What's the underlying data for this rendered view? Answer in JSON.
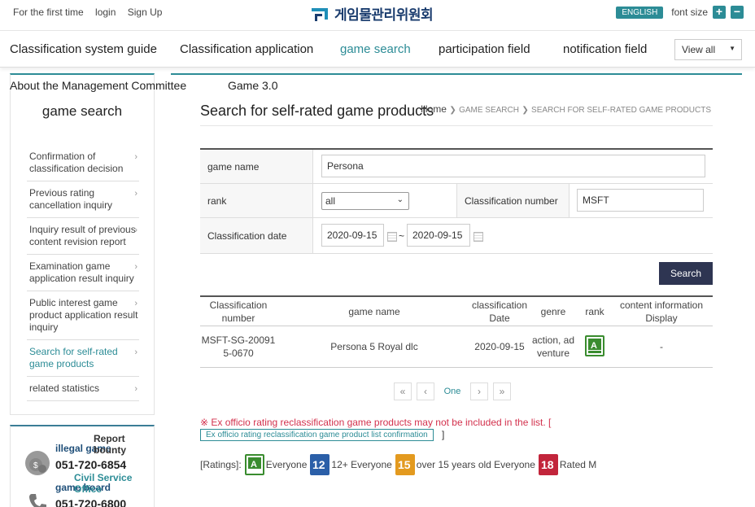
{
  "top": {
    "links": [
      "For the first time",
      "login",
      "Sign Up"
    ],
    "logo_text": "게임물관리위원회",
    "english": "ENGLISH",
    "font_size": "font size",
    "plus": "+",
    "minus": "−"
  },
  "gnb": {
    "items": [
      "Classification system guide",
      "Classification application",
      "game search",
      "participation field",
      "notification field"
    ],
    "active": "game search",
    "view_all": "View all"
  },
  "sub_nav": [
    "About the Management Committee",
    "Game 3.0"
  ],
  "lnb": {
    "title": "game search",
    "items": [
      "Confirmation of classification decision",
      "Previous rating cancellation inquiry",
      "Inquiry result of previous content revision report",
      "Examination game application result inquiry",
      "Public interest game product application result inquiry",
      "Search for self-rated game products",
      "related statistics"
    ],
    "active_index": 5
  },
  "contact": [
    {
      "label": "illegal game",
      "label2": "Report bounty",
      "phone": "051-720-6854",
      "icon": "money-bag-icon"
    },
    {
      "label": "game board",
      "label2": "Civil Service Office",
      "phone": "051-720-6800",
      "icon": "phone-icon"
    }
  ],
  "page": {
    "title": "Search for self-rated game products",
    "breadcrumb": {
      "home": "Home",
      "level1": "GAME SEARCH",
      "level2": "SEARCH FOR SELF-RATED GAME PRODUCTS"
    }
  },
  "form": {
    "game_name_label": "game name",
    "game_name_value": "Persona",
    "rank_label": "rank",
    "rank_value": "all",
    "classification_number_label": "Classification number",
    "classification_number_value": "MSFT",
    "date_label": "Classification date",
    "date_from": "2020-09-15",
    "date_to": "2020-09-15",
    "tilde": "~",
    "search_button": "Search"
  },
  "table": {
    "headers": [
      "Classification number",
      "game name",
      "classification Date",
      "genre",
      "rank",
      "content information Display"
    ],
    "rows": [
      {
        "number": "MSFT-SG-20091 5-0670",
        "number_line1": "MSFT-SG-20091",
        "number_line2": "5-0670",
        "name": "Persona 5 Royal dlc",
        "date": "2020-09-15",
        "genre_line1": "action, ad",
        "genre_line2": "venture",
        "rank_icon": "rating-all-icon",
        "content_info": "-"
      }
    ]
  },
  "pager": {
    "first": "«",
    "prev": "‹",
    "current": "One",
    "next": "›",
    "last": "»"
  },
  "notice": {
    "text": "※ Ex officio rating reclassification game products may not be included in the list. [",
    "link": "Ex officio rating reclassification game product list confirmation",
    "end": "]"
  },
  "ratings": {
    "label": "[Ratings]:",
    "items": [
      {
        "name": "Everyone",
        "color": "#3a8c2f",
        "icon": "rating-all-icon"
      },
      {
        "name": "12+ Everyone",
        "color": "#2b5fa8",
        "icon": "rating-12-icon"
      },
      {
        "name": "over 15 years old Everyone",
        "color": "#e39a1f",
        "icon": "rating-15-icon"
      },
      {
        "name": "Rated M",
        "color": "#c2253b",
        "icon": "rating-18-icon"
      }
    ]
  },
  "colors": {
    "accent": "#2c8c96",
    "navy": "#2e3552",
    "notice": "#d3314d"
  }
}
